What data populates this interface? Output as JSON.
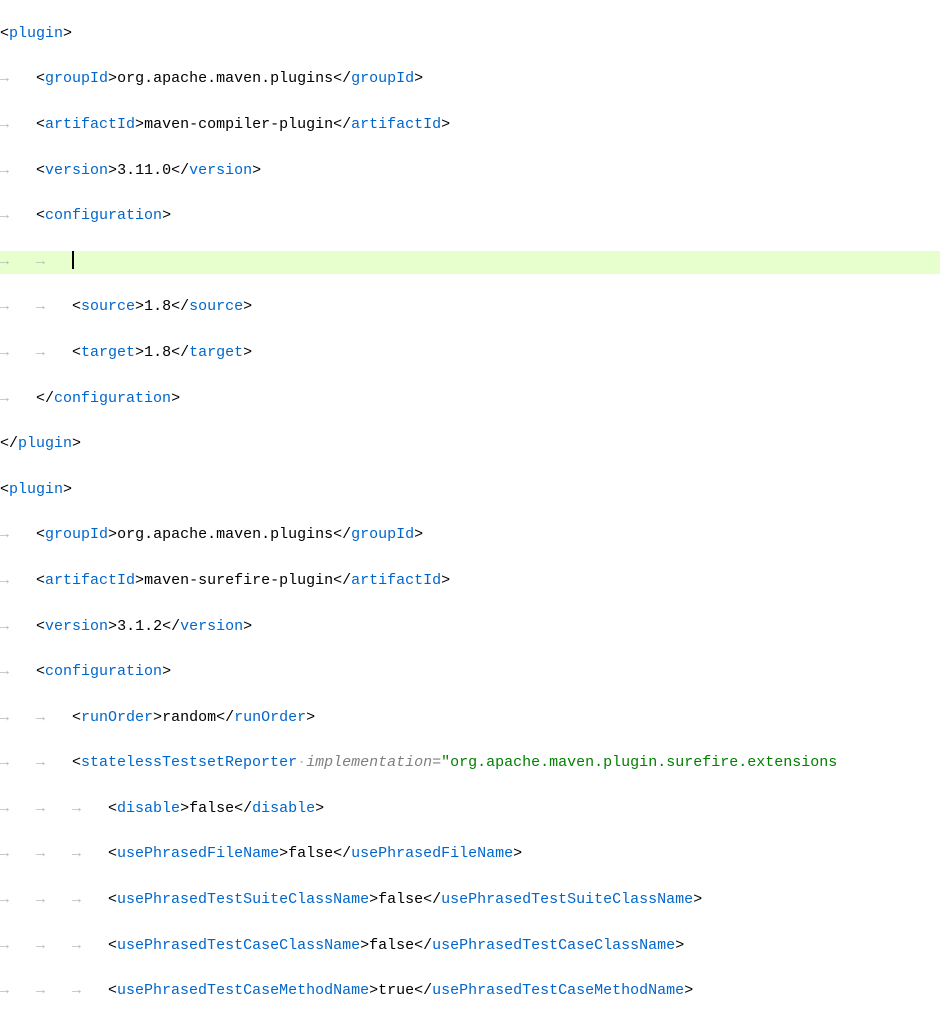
{
  "ws": {
    "arrow": "→",
    "dot": "·",
    "arrow_pad": "→   ",
    "arrow2": "→   →   ",
    "arrow3": "→   →   →   "
  },
  "t": {
    "lt": "<",
    "gt": ">",
    "lts": "</",
    "quote": "\"",
    "eq": "="
  },
  "tags": {
    "plugin": "plugin",
    "groupId": "groupId",
    "artifactId": "artifactId",
    "version": "version",
    "configuration": "configuration",
    "source": "source",
    "target": "target",
    "runOrder": "runOrder",
    "statelessTestsetReporter": "statelessTestsetReporter",
    "disable": "disable",
    "usePhrasedFileName": "usePhrasedFileName",
    "usePhrasedTestSuiteClassName": "usePhrasedTestSuiteClassName",
    "usePhrasedTestCaseClassName": "usePhrasedTestCaseClassName",
    "usePhrasedTestCaseMethodName": "usePhrasedTestCaseMethodName"
  },
  "attr": {
    "implementation": "implementation"
  },
  "vals": {
    "mavenPlugins": "org.apache.maven.plugins",
    "compilerPlugin": "maven-compiler-plugin",
    "v3110": "3.11.0",
    "v18": "1.8",
    "surefirePlugin": "maven-surefire-plugin",
    "v312": "3.1.2",
    "random": "random",
    "surefireExt": "org.apache.maven.plugin.surefire.extensions",
    "false": "false",
    "true": "true"
  },
  "chart_data": {
    "type": "table",
    "title": "Maven pom.xml plugin configuration snippet",
    "plugins": [
      {
        "groupId": "org.apache.maven.plugins",
        "artifactId": "maven-compiler-plugin",
        "version": "3.11.0",
        "configuration": {
          "source": "1.8",
          "target": "1.8"
        }
      },
      {
        "groupId": "org.apache.maven.plugins",
        "artifactId": "maven-surefire-plugin",
        "version": "3.1.2",
        "configuration": {
          "runOrder": "random",
          "statelessTestsetReporter": {
            "implementation": "org.apache.maven.plugin.surefire.extensions",
            "disable": "false",
            "usePhrasedFileName": "false",
            "usePhrasedTestSuiteClassName": "false",
            "usePhrasedTestCaseClassName": "false",
            "usePhrasedTestCaseMethodName": "true"
          }
        }
      }
    ]
  }
}
